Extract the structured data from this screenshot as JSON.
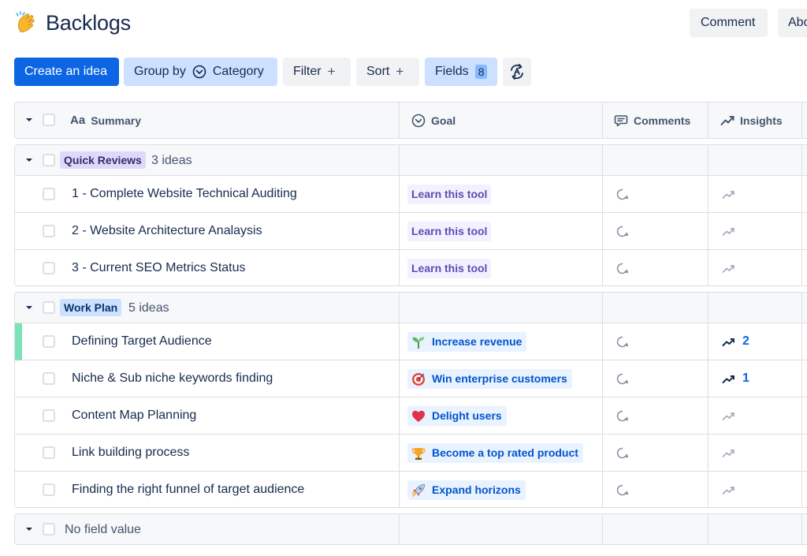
{
  "header": {
    "title": "Backlogs",
    "title_icon": "clapping-hands-icon",
    "comment_label": "Comment",
    "about_label": "About"
  },
  "toolbar": {
    "create_label": "Create an idea",
    "group_by_label": "Group by",
    "group_by_value": "Category",
    "filter_label": "Filter",
    "sort_label": "Sort",
    "fields_label": "Fields",
    "fields_count": "8"
  },
  "columns": {
    "summary": "Summary",
    "goal": "Goal",
    "comments": "Comments",
    "insights": "Insights"
  },
  "groups": [
    {
      "label": "Quick Reviews",
      "count": "3 ideas",
      "color": "#dfd8fd",
      "text_color": "#352c63",
      "rows": [
        {
          "summary": "1 - Complete Website Technical Auditing",
          "goal": "Learn this tool",
          "goal_style": "learn",
          "insights": ""
        },
        {
          "summary": "2 - Website Architecture Analaysis",
          "goal": "Learn this tool",
          "goal_style": "learn",
          "insights": ""
        },
        {
          "summary": "3 - Current SEO Metrics Status",
          "goal": "Learn this tool",
          "goal_style": "learn",
          "insights": ""
        }
      ]
    },
    {
      "label": "Work Plan",
      "count": "5 ideas",
      "color": "#cce0ff",
      "text_color": "#09326c",
      "rows": [
        {
          "summary": "Defining Target Audience",
          "goal": "Increase revenue",
          "goal_icon": "seedling-icon",
          "insights": "2"
        },
        {
          "summary": "Niche & Sub niche keywords finding",
          "goal": "Win enterprise customers",
          "goal_icon": "target-icon",
          "insights": "1"
        },
        {
          "summary": "Content Map Planning",
          "goal": "Delight users",
          "goal_icon": "heart-icon",
          "insights": ""
        },
        {
          "summary": "Link building process",
          "goal": "Become a top rated product",
          "goal_icon": "trophy-icon",
          "insights": ""
        },
        {
          "summary": "Finding the right funnel of target audience",
          "goal": "Expand horizons",
          "goal_icon": "rocket-icon",
          "insights": ""
        }
      ]
    },
    {
      "label": "No field value"
    }
  ],
  "colors": {
    "primary": "#0c66e4",
    "selected": "#cce0ff",
    "learn_badge": "#f3f0ff",
    "goal_badge": "#e9f2ff",
    "row_accent": "#7ee2b8"
  }
}
